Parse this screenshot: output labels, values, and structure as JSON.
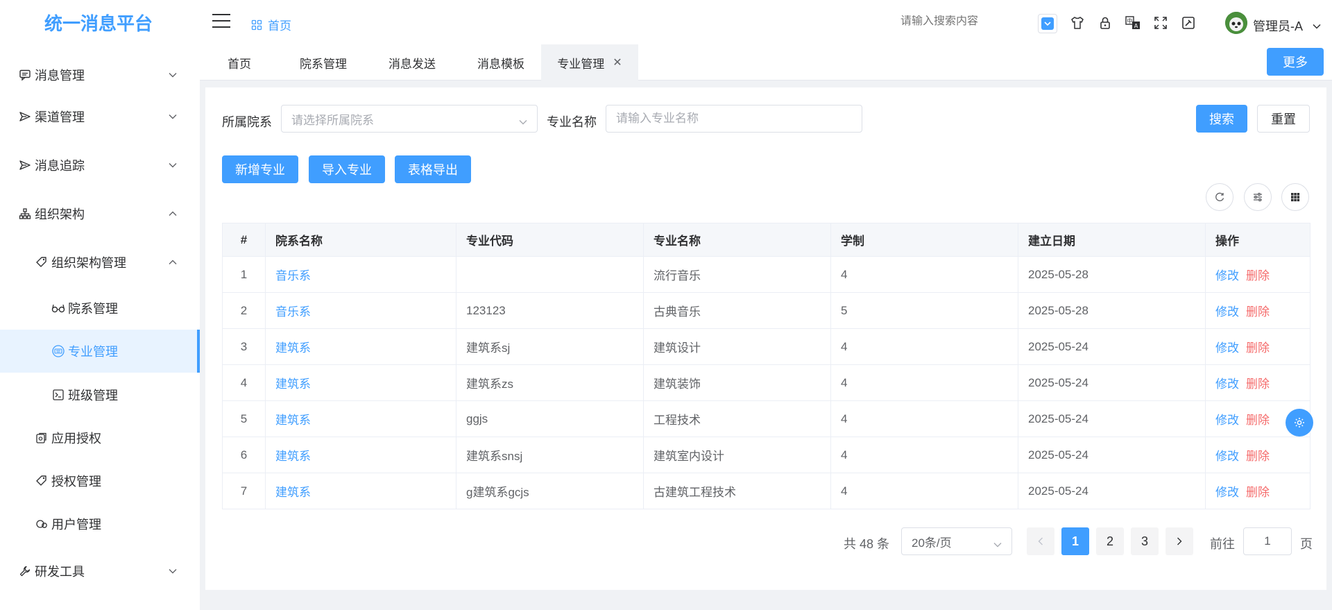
{
  "app": {
    "title": "统一消息平台"
  },
  "sidebar": {
    "items": [
      {
        "label": "消息管理",
        "icon": "message-icon"
      },
      {
        "label": "渠道管理",
        "icon": "send-icon"
      },
      {
        "label": "消息追踪",
        "icon": "send-icon"
      },
      {
        "label": "组织架构",
        "icon": "org-tree-icon"
      },
      {
        "label": "组织架构管理",
        "icon": "tag-icon"
      },
      {
        "label": "院系管理",
        "icon": "glasses-icon"
      },
      {
        "label": "专业管理",
        "icon": "keyboard-icon",
        "active": true
      },
      {
        "label": "班级管理",
        "icon": "list-icon"
      },
      {
        "label": "应用授权",
        "icon": "app-auth-icon"
      },
      {
        "label": "授权管理",
        "icon": "tag-icon"
      },
      {
        "label": "用户管理",
        "icon": "user-icon"
      },
      {
        "label": "研发工具",
        "icon": "wrench-icon"
      }
    ]
  },
  "header": {
    "breadcrumb": "首页",
    "search_placeholder": "请输入搜索内容",
    "user_name": "管理员-A"
  },
  "tabs": [
    {
      "label": "首页"
    },
    {
      "label": "院系管理"
    },
    {
      "label": "消息发送"
    },
    {
      "label": "消息模板"
    },
    {
      "label": "专业管理",
      "active": true,
      "closable": true
    }
  ],
  "tabs_more": "更多",
  "filters": {
    "dept_label": "所属院系",
    "dept_placeholder": "请选择所属院系",
    "major_label": "专业名称",
    "major_placeholder": "请输入专业名称",
    "search_button": "搜索",
    "reset_button": "重置"
  },
  "toolbar": {
    "add": "新增专业",
    "import": "导入专业",
    "export": "表格导出"
  },
  "table": {
    "columns": [
      "#",
      "院系名称",
      "专业代码",
      "专业名称",
      "学制",
      "建立日期",
      "操作"
    ],
    "rows": [
      {
        "idx": "1",
        "dept": "音乐系",
        "code": "",
        "name": "流行音乐",
        "years": "4",
        "date": "2025-05-28"
      },
      {
        "idx": "2",
        "dept": "音乐系",
        "code": "123123",
        "name": "古典音乐",
        "years": "5",
        "date": "2025-05-28"
      },
      {
        "idx": "3",
        "dept": "建筑系",
        "code": "建筑系sj",
        "name": "建筑设计",
        "years": "4",
        "date": "2025-05-24"
      },
      {
        "idx": "4",
        "dept": "建筑系",
        "code": "建筑系zs",
        "name": "建筑装饰",
        "years": "4",
        "date": "2025-05-24"
      },
      {
        "idx": "5",
        "dept": "建筑系",
        "code": "ggjs",
        "name": "工程技术",
        "years": "4",
        "date": "2025-05-24"
      },
      {
        "idx": "6",
        "dept": "建筑系",
        "code": "建筑系snsj",
        "name": "建筑室内设计",
        "years": "4",
        "date": "2025-05-24"
      },
      {
        "idx": "7",
        "dept": "建筑系",
        "code": "g建筑系gcjs",
        "name": "古建筑工程技术",
        "years": "4",
        "date": "2025-05-24"
      }
    ],
    "edit_label": "修改",
    "delete_label": "删除"
  },
  "pagination": {
    "total": "共 48 条",
    "page_size": "20条/页",
    "pages": [
      "1",
      "2",
      "3"
    ],
    "current": "1",
    "goto_label": "前往",
    "goto_value": "1",
    "page_suffix": "页"
  },
  "colors": {
    "primary": "#409eff",
    "danger": "#f56c6c"
  }
}
